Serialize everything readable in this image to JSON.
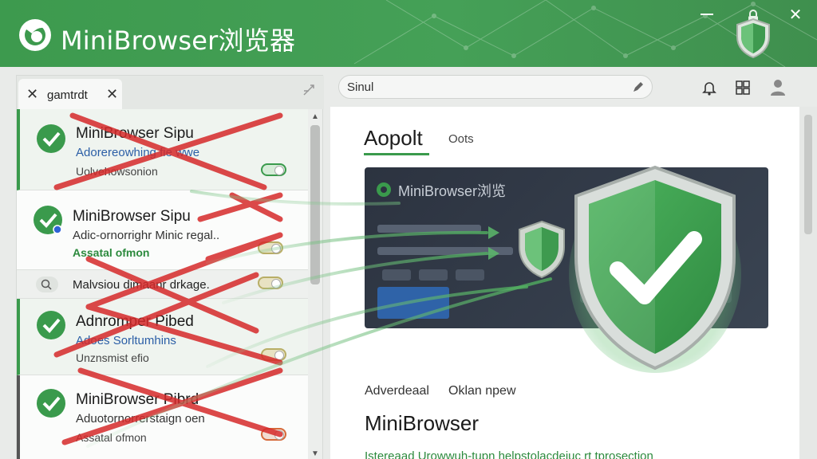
{
  "window": {
    "title": "MiniBrowser浏览器",
    "minimize_label": "",
    "close_label": "✕"
  },
  "left": {
    "tab_label": "gamtrdt",
    "items": [
      {
        "title": "MiniBrowser Sipu",
        "subtitle": "Adorereowhing fie wwe",
        "meta": "Uolvehowsonion"
      },
      {
        "title": "MiniBrowser Sipu",
        "subtitle": "Adic-ornorrighr Minic regal..",
        "meta": "Assatal ofmon"
      },
      {
        "title": "Adnromper Pibed",
        "subtitle": "Adoes Sorltumhins",
        "meta": "Unznsmist efio"
      },
      {
        "title": "MiniBrowser Pibrd",
        "subtitle": "Aduotornorrerstaign oen",
        "meta": "Assatal ofmon"
      }
    ],
    "search_text": "Malvsiou dimaanr drkage."
  },
  "topbar": {
    "address": "Sinul"
  },
  "content": {
    "tab_active": "Aopolt",
    "tab_other": "Oots",
    "hero_title": "MiniBrowser浏览",
    "adv_left": "Adverdeaal",
    "adv_right": "Oklan npew",
    "product": "MiniBrowser",
    "bottom_text": "Istereaad Urowwuh-tupn helpstolacdeiuc rt tprosection"
  },
  "colors": {
    "accent": "#3a9a4c",
    "titlebar": "#45a057",
    "reject_marks": "#d62a2a"
  }
}
